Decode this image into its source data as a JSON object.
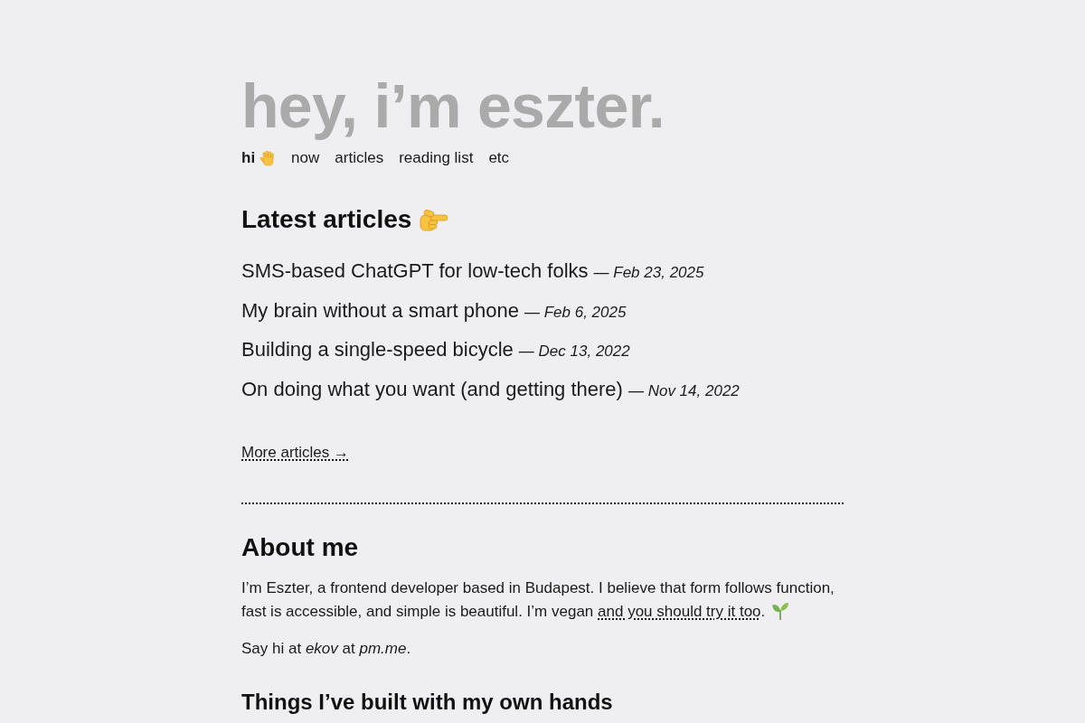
{
  "header": {
    "title": "hey, i’m eszter."
  },
  "nav": {
    "items": [
      {
        "label": "hi",
        "selected": true,
        "kind": "greeting"
      },
      {
        "label": "now",
        "selected": false,
        "kind": "plain"
      },
      {
        "label": "articles",
        "selected": false,
        "kind": "plain"
      },
      {
        "label": "reading list",
        "selected": false,
        "kind": "plain"
      },
      {
        "label": "etc",
        "selected": false,
        "kind": "plain"
      }
    ]
  },
  "latest": {
    "heading": "Latest articles",
    "articles": [
      {
        "title": "SMS-based ChatGPT for low-tech folks",
        "date": "— Feb 23, 2025"
      },
      {
        "title": "My brain without a smart phone",
        "date": "— Feb 6, 2025"
      },
      {
        "title": "Building a single-speed bicycle",
        "date": "— Dec 13, 2022"
      },
      {
        "title": "On doing what you want (and getting there)",
        "date": "— Nov 14, 2022"
      }
    ],
    "more_link": "More articles →"
  },
  "about": {
    "heading": "About me",
    "paragraph": {
      "text": "I’m Eszter, a frontend developer based in Budapest. I believe that form follows function, fast is accessible, and simple is beautiful. I’m vegan",
      "link": "and you should try it too",
      "end": "."
    },
    "contact": "Say hi at *ekov* at *pm.me*."
  },
  "built": {
    "heading": "Things I’ve built with my own hands"
  }
}
